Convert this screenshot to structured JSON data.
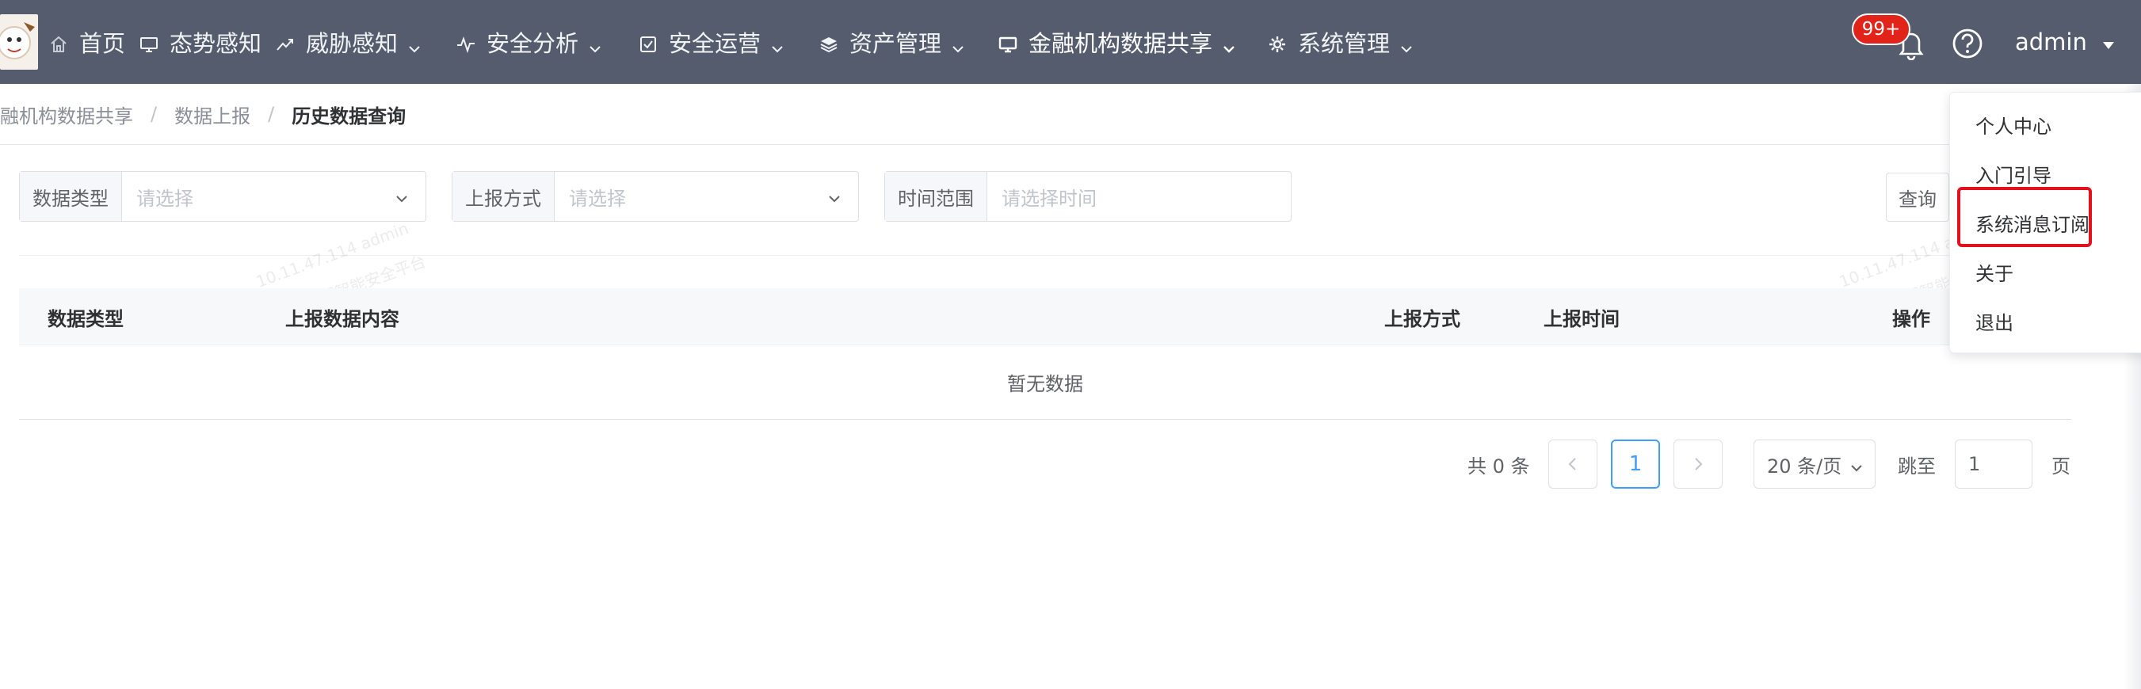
{
  "nav": {
    "items": [
      {
        "label": "首页",
        "icon": "home-icon"
      },
      {
        "label": "态势感知",
        "icon": "monitor-icon"
      },
      {
        "label": "威胁感知",
        "icon": "trend-icon"
      },
      {
        "label": "安全分析",
        "icon": "pulse-icon"
      },
      {
        "label": "安全运营",
        "icon": "checkbox-icon"
      },
      {
        "label": "资产管理",
        "icon": "layers-icon"
      },
      {
        "label": "金融机构数据共享",
        "icon": "monitor-icon"
      },
      {
        "label": "系统管理",
        "icon": "gear-icon"
      }
    ],
    "notification_count": "99+",
    "user": "admin"
  },
  "breadcrumb": {
    "items": [
      "融机构数据共享",
      "数据上报",
      "历史数据查询"
    ]
  },
  "filters": {
    "data_type": {
      "label": "数据类型",
      "placeholder": "请选择"
    },
    "report_method": {
      "label": "上报方式",
      "placeholder": "请选择"
    },
    "time_range": {
      "label": "时间范围",
      "placeholder": "请选择时间"
    },
    "query_button": "查询"
  },
  "table": {
    "columns": [
      "数据类型",
      "上报数据内容",
      "上报方式",
      "上报时间",
      "操作"
    ],
    "empty_text": "暂无数据"
  },
  "watermark": {
    "line1": "10.11.47.114 admin",
    "line2": "AILPHA大数据智能安全平台"
  },
  "pagination": {
    "total": "共 0 条",
    "current_page": "1",
    "page_size": "20 条/页",
    "jump_label": "跳至",
    "jump_value": "1",
    "page_unit": "页"
  },
  "user_menu": {
    "items": [
      "个人中心",
      "入门引导",
      "系统消息订阅",
      "关于",
      "退出"
    ],
    "highlighted_item": "系统消息订阅"
  },
  "colors": {
    "topbar": "#545c6d",
    "badge": "#e2231a",
    "highlight": "#e5101d",
    "active_page": "#409eff"
  }
}
